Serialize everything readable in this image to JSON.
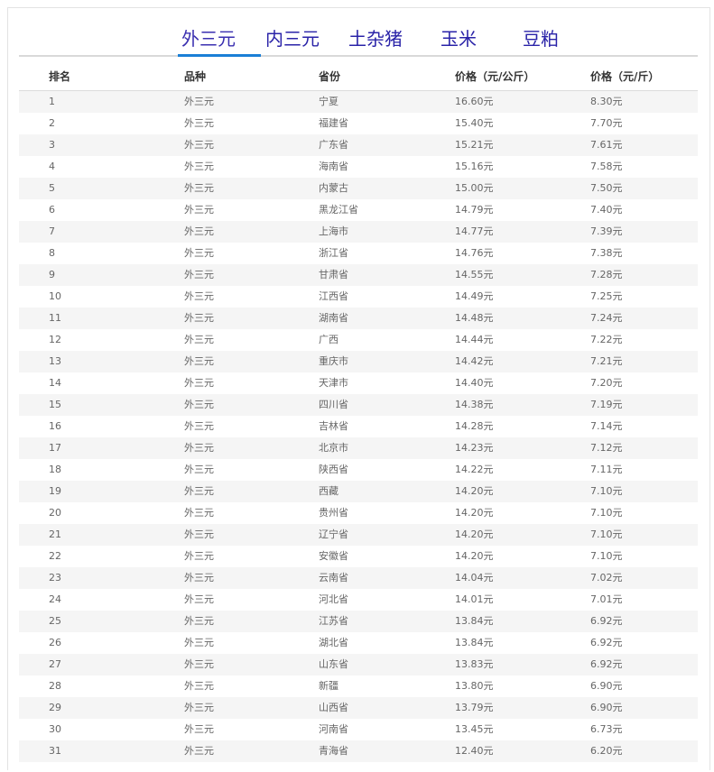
{
  "tabs": [
    {
      "label": "外三元",
      "active": true
    },
    {
      "label": "内三元",
      "active": false
    },
    {
      "label": "土杂猪",
      "active": false
    },
    {
      "label": "玉米",
      "active": false
    },
    {
      "label": "豆粕",
      "active": false
    }
  ],
  "table": {
    "headers": [
      "排名",
      "品种",
      "省份",
      "价格（元/公斤）",
      "价格（元/斤）"
    ],
    "rows": [
      [
        "1",
        "外三元",
        "宁夏",
        "16.60元",
        "8.30元"
      ],
      [
        "2",
        "外三元",
        "福建省",
        "15.40元",
        "7.70元"
      ],
      [
        "3",
        "外三元",
        "广东省",
        "15.21元",
        "7.61元"
      ],
      [
        "4",
        "外三元",
        "海南省",
        "15.16元",
        "7.58元"
      ],
      [
        "5",
        "外三元",
        "内蒙古",
        "15.00元",
        "7.50元"
      ],
      [
        "6",
        "外三元",
        "黑龙江省",
        "14.79元",
        "7.40元"
      ],
      [
        "7",
        "外三元",
        "上海市",
        "14.77元",
        "7.39元"
      ],
      [
        "8",
        "外三元",
        "浙江省",
        "14.76元",
        "7.38元"
      ],
      [
        "9",
        "外三元",
        "甘肃省",
        "14.55元",
        "7.28元"
      ],
      [
        "10",
        "外三元",
        "江西省",
        "14.49元",
        "7.25元"
      ],
      [
        "11",
        "外三元",
        "湖南省",
        "14.48元",
        "7.24元"
      ],
      [
        "12",
        "外三元",
        "广西",
        "14.44元",
        "7.22元"
      ],
      [
        "13",
        "外三元",
        "重庆市",
        "14.42元",
        "7.21元"
      ],
      [
        "14",
        "外三元",
        "天津市",
        "14.40元",
        "7.20元"
      ],
      [
        "15",
        "外三元",
        "四川省",
        "14.38元",
        "7.19元"
      ],
      [
        "16",
        "外三元",
        "吉林省",
        "14.28元",
        "7.14元"
      ],
      [
        "17",
        "外三元",
        "北京市",
        "14.23元",
        "7.12元"
      ],
      [
        "18",
        "外三元",
        "陕西省",
        "14.22元",
        "7.11元"
      ],
      [
        "19",
        "外三元",
        "西藏",
        "14.20元",
        "7.10元"
      ],
      [
        "20",
        "外三元",
        "贵州省",
        "14.20元",
        "7.10元"
      ],
      [
        "21",
        "外三元",
        "辽宁省",
        "14.20元",
        "7.10元"
      ],
      [
        "22",
        "外三元",
        "安徽省",
        "14.20元",
        "7.10元"
      ],
      [
        "23",
        "外三元",
        "云南省",
        "14.04元",
        "7.02元"
      ],
      [
        "24",
        "外三元",
        "河北省",
        "14.01元",
        "7.01元"
      ],
      [
        "25",
        "外三元",
        "江苏省",
        "13.84元",
        "6.92元"
      ],
      [
        "26",
        "外三元",
        "湖北省",
        "13.84元",
        "6.92元"
      ],
      [
        "27",
        "外三元",
        "山东省",
        "13.83元",
        "6.92元"
      ],
      [
        "28",
        "外三元",
        "新疆",
        "13.80元",
        "6.90元"
      ],
      [
        "29",
        "外三元",
        "山西省",
        "13.79元",
        "6.90元"
      ],
      [
        "30",
        "外三元",
        "河南省",
        "13.45元",
        "6.73元"
      ],
      [
        "31",
        "外三元",
        "青海省",
        "12.40元",
        "6.20元"
      ]
    ]
  }
}
